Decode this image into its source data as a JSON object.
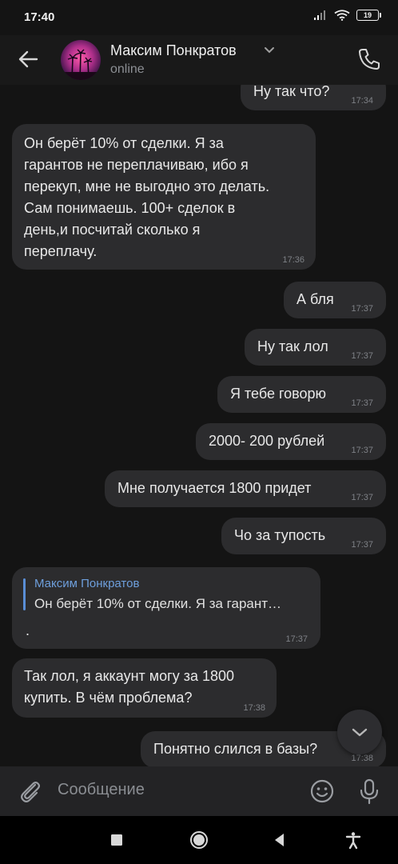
{
  "status_bar": {
    "time": "17:40",
    "battery": "19"
  },
  "header": {
    "name": "Максим Понкратов",
    "status": "online"
  },
  "messages": [
    {
      "text": "Ну так что?",
      "time": "17:34"
    },
    {
      "text": "Он берёт 10% от сделки. Я за\nгарантов не переплачиваю, ибо я\nперекуп, мне не выгодно это делать.\nСам понимаешь. 100+ сделок в\nдень,и посчитай сколько я\nпереплачу.",
      "time": "17:36"
    },
    {
      "text": "А бля",
      "time": "17:37"
    },
    {
      "text": "Ну так лол",
      "time": "17:37"
    },
    {
      "text": "Я тебе говорю",
      "time": "17:37"
    },
    {
      "text": "2000- 200 рублей",
      "time": "17:37"
    },
    {
      "text": "Мне получается 1800 придет",
      "time": "17:37"
    },
    {
      "text": "Чо за тупость",
      "time": "17:37"
    },
    {
      "reply_name": "Максим Понкратов",
      "reply_text": "Он берёт 10% от сделки. Я за гарант…",
      "text": ".",
      "time": "17:37"
    },
    {
      "text": "Так лол, я аккаунт могу за 1800\nкупить. В чём проблема?",
      "time": "17:38"
    },
    {
      "text": "Понятно слился в базы?",
      "time": "17:38"
    }
  ],
  "composer": {
    "placeholder": "Сообщение"
  },
  "icons": {
    "back": "arrow-left-icon",
    "call": "phone-icon",
    "attach": "paperclip-icon",
    "emoji": "smile-icon",
    "mic": "microphone-icon",
    "scroll_down": "chevron-down-icon"
  },
  "colors": {
    "background": "#141414",
    "bubble": "#2c2c2e",
    "accent": "#6e9fdc",
    "time": "#7e8186"
  }
}
